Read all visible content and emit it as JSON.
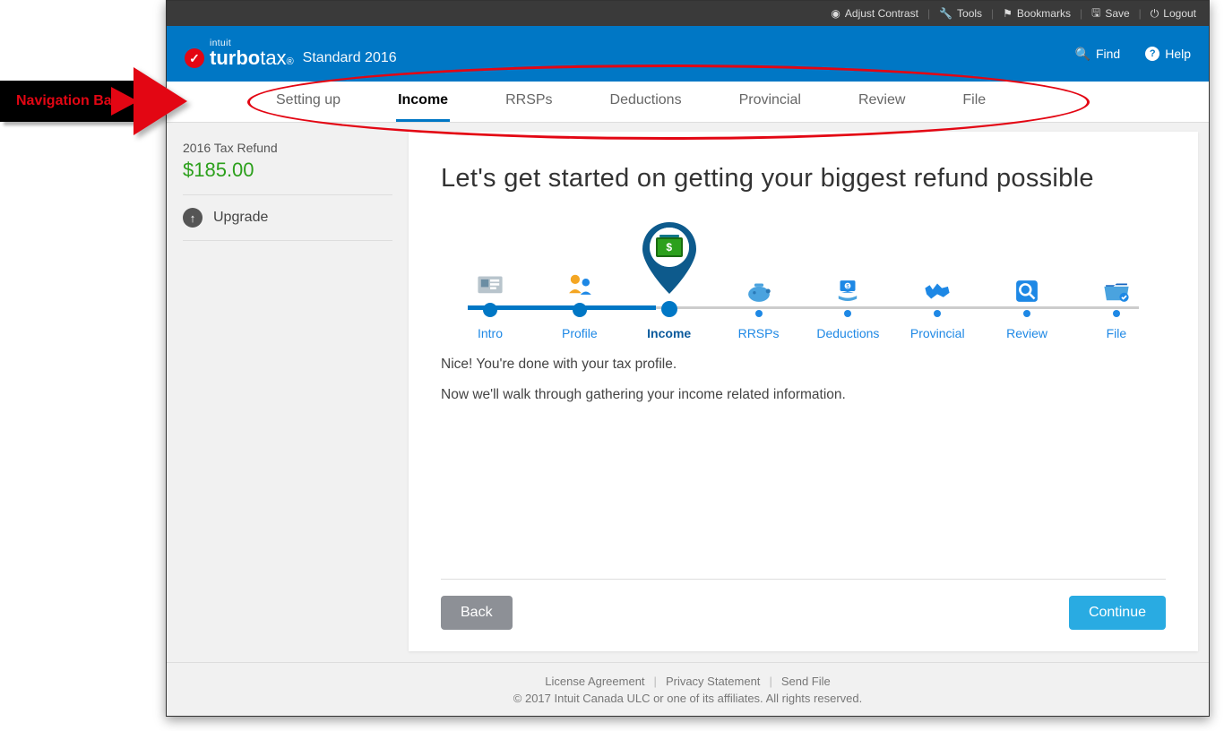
{
  "annotation": {
    "label": "Navigation Bar"
  },
  "topbar": {
    "contrast": "Adjust Contrast",
    "tools": "Tools",
    "bookmarks": "Bookmarks",
    "save": "Save",
    "logout": "Logout"
  },
  "brand": {
    "intuit": "intuit",
    "product": "turbotax",
    "version": "Standard 2016"
  },
  "bluebar": {
    "find": "Find",
    "help": "Help"
  },
  "navbar": {
    "tabs": [
      {
        "label": "Setting up",
        "active": false
      },
      {
        "label": "Income",
        "active": true
      },
      {
        "label": "RRSPs",
        "active": false
      },
      {
        "label": "Deductions",
        "active": false
      },
      {
        "label": "Provincial",
        "active": false
      },
      {
        "label": "Review",
        "active": false
      },
      {
        "label": "File",
        "active": false
      }
    ]
  },
  "sidebar": {
    "refund_label": "2016 Tax Refund",
    "refund_amount": "$185.00",
    "upgrade": "Upgrade"
  },
  "main": {
    "title": "Let's get started on getting your biggest refund possible",
    "steps": [
      {
        "label": "Intro",
        "state": "done"
      },
      {
        "label": "Profile",
        "state": "done"
      },
      {
        "label": "Income",
        "state": "current"
      },
      {
        "label": "RRSPs",
        "state": "upcoming"
      },
      {
        "label": "Deductions",
        "state": "upcoming"
      },
      {
        "label": "Provincial",
        "state": "upcoming"
      },
      {
        "label": "Review",
        "state": "upcoming"
      },
      {
        "label": "File",
        "state": "upcoming"
      }
    ],
    "text1": "Nice! You're done with your tax profile.",
    "text2": "Now we'll walk through gathering your income related information.",
    "back": "Back",
    "continue": "Continue"
  },
  "footer": {
    "license": "License Agreement",
    "privacy": "Privacy Statement",
    "sendfile": "Send File",
    "copyright": "© 2017 Intuit Canada ULC or one of its affiliates. All rights reserved."
  }
}
